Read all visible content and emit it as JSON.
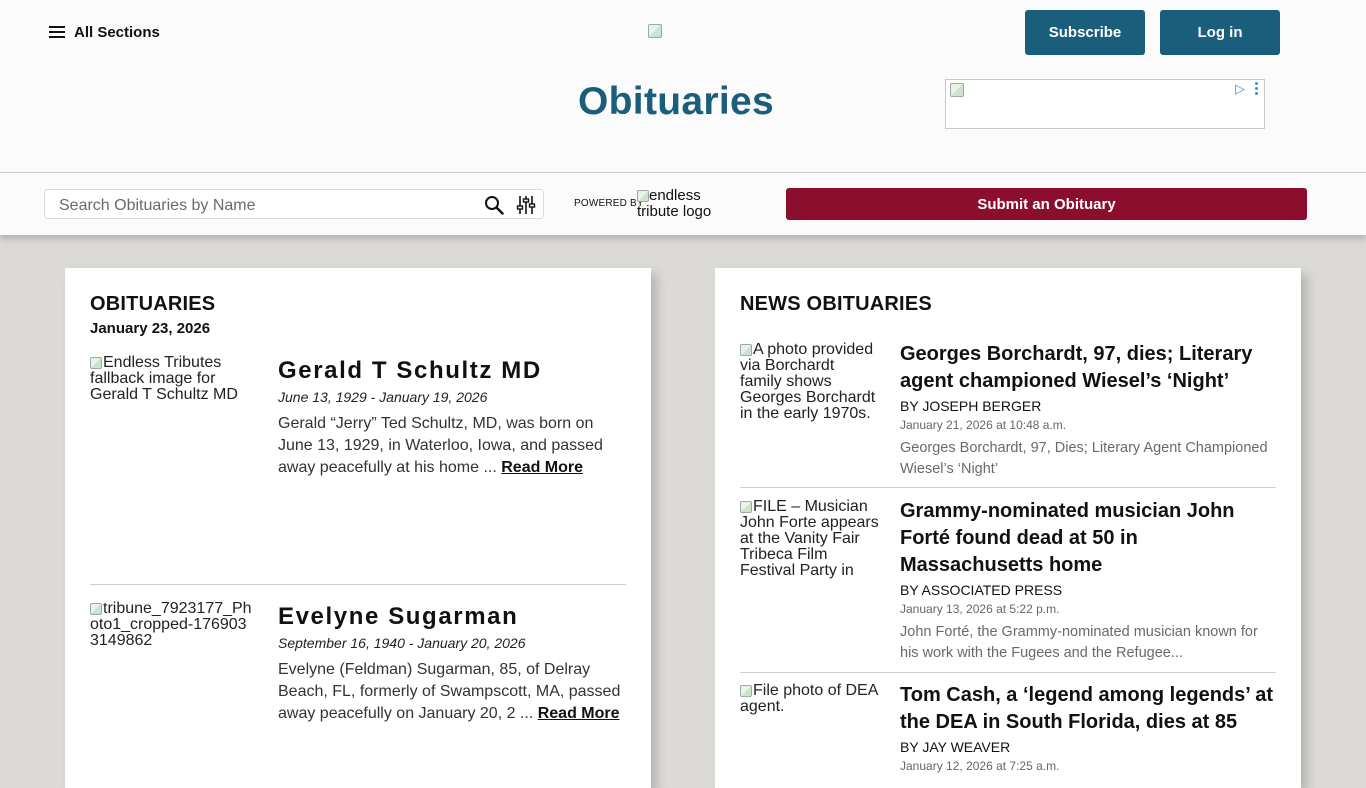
{
  "header": {
    "all_sections_label": "All Sections",
    "logo_alt": "",
    "subscribe_label": "Subscribe",
    "login_label": "Log in",
    "page_title": "Obituaries",
    "brand_color": "#1b5e7c",
    "ad_icons": [
      "ad-choices-icon",
      "more-vertical-icon"
    ]
  },
  "search": {
    "placeholder": "Search Obituaries by Name",
    "value": "",
    "icons": [
      "search-icon",
      "filter-sliders-icon"
    ],
    "powered_by": "POWERED BY",
    "partner_logo_alt": "endless tribute logo",
    "submit_label": "Submit an Obituary",
    "submit_color": "#8b0e2e"
  },
  "obituaries": {
    "heading": "OBITUARIES",
    "date": "January 23, 2026",
    "items": [
      {
        "image_alt": "Endless Tributes fallback image for Gerald T Schultz MD",
        "name": "Gerald T Schultz MD",
        "dates": "June 13, 1929 - January 19, 2026",
        "excerpt": "Gerald “Jerry” Ted Schultz, MD, was born on June 13, 1929, in Waterloo, Iowa, and passed away peacefully at his home ...",
        "read_more": "Read More"
      },
      {
        "image_alt": "tribune_7923177_Photo1_cropped-1769033149862",
        "name": "Evelyne Sugarman",
        "dates": "September 16, 1940 - January 20, 2026",
        "excerpt": "Evelyne (Feldman) Sugarman, 85, of Delray Beach, FL, formerly of Swampscott, MA, passed away peacefully on January 20, 2 ...",
        "read_more": "Read More"
      }
    ]
  },
  "news_obituaries": {
    "heading": "NEWS OBITUARIES",
    "items": [
      {
        "image_alt": "A photo provided via Borchardt family shows Georges Borchardt in the early 1970s.",
        "title": "Georges Borchardt, 97, dies; Literary agent championed Wiesel’s ‘Night’",
        "byline": "BY JOSEPH BERGER",
        "time": "January 21, 2026 at 10:48 a.m.",
        "description": "Georges Borchardt, 97, Dies; Literary Agent Championed Wiesel’s ‘Night’"
      },
      {
        "image_alt": "FILE – Musician John Forte appears at the Vanity Fair Tribeca Film Festival Party in",
        "title": "Grammy-nominated musician John Forté found dead at 50 in Massachusetts home",
        "byline": "BY ASSOCIATED PRESS",
        "time": "January 13, 2026 at 5:22 p.m.",
        "description": "John Forté, the Grammy-nominated musician known for his work with the Fugees and the Refugee..."
      },
      {
        "image_alt": "File photo of DEA agent.",
        "title": "Tom Cash, a ‘legend among legends’ at the DEA in South Florida, dies at 85",
        "byline": "BY JAY WEAVER",
        "time": "January 12, 2026 at 7:25 a.m.",
        "description": ""
      }
    ]
  }
}
